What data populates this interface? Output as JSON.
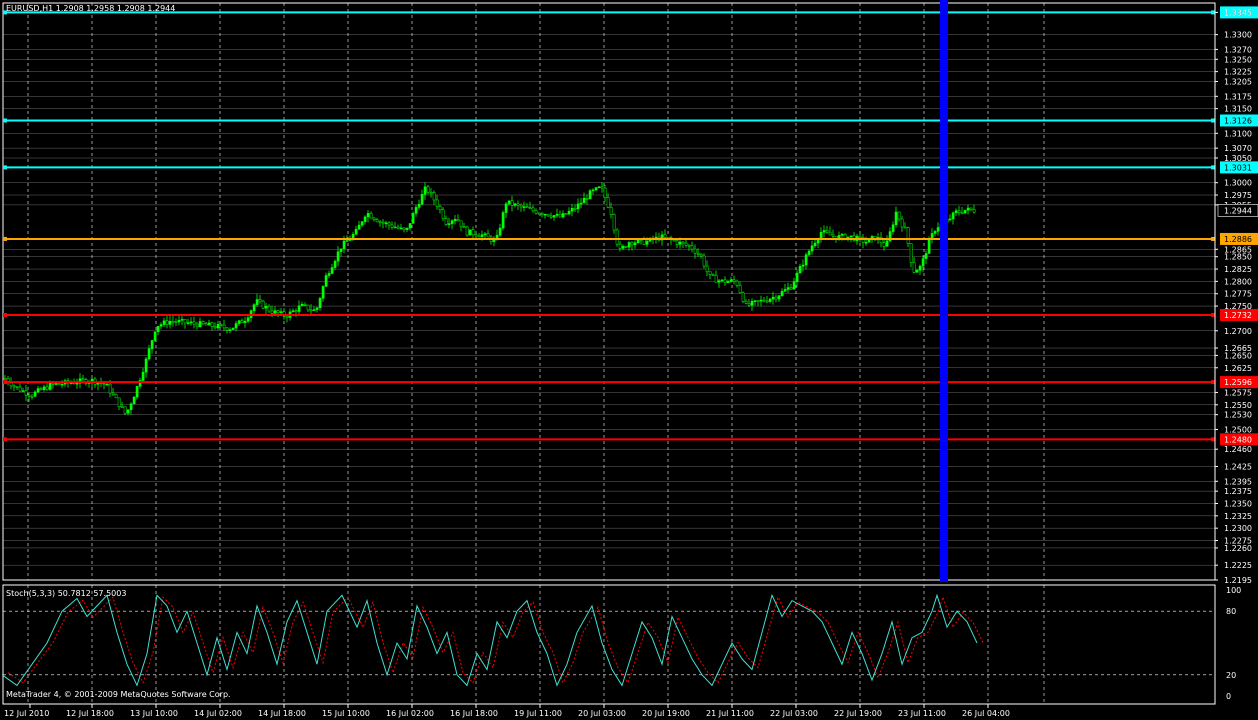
{
  "header": {
    "symbol_line": "EURUSD,H1  1.2908 1.2958 1.2908 1.2944"
  },
  "footer": {
    "copyright": "MetaTrader 4, © 2001-2009 MetaQuotes Software Corp."
  },
  "indicator": {
    "label": "Stoch(5,3,3) 50.7812 57.5003",
    "levels": [
      "100",
      "80",
      "20",
      "0"
    ],
    "level_values": [
      100,
      80,
      20,
      0
    ]
  },
  "colors": {
    "background": "#000000",
    "grid": "#ffffff",
    "bull_candle": "#00ff00",
    "hline_cyan": "#00ffff",
    "hline_orange": "#ffa500",
    "hline_red": "#ff0000",
    "vband_blue": "#0000ff",
    "stoch_main": "#40e0d0",
    "stoch_signal": "#ff0000"
  },
  "price_axis": {
    "ticks": [
      "1.3345",
      "1.3300",
      "1.3270",
      "1.3250",
      "1.3225",
      "1.3205",
      "1.3175",
      "1.3150",
      "1.3100",
      "1.3070",
      "1.3050",
      "1.3000",
      "1.2975",
      "1.2955",
      "1.2865",
      "1.2850",
      "1.2825",
      "1.2800",
      "1.2775",
      "1.2750",
      "1.2700",
      "1.2665",
      "1.2650",
      "1.2625",
      "1.2575",
      "1.2550",
      "1.2530",
      "1.2500",
      "1.2460",
      "1.2425",
      "1.2395",
      "1.2375",
      "1.2350",
      "1.2325",
      "1.2300",
      "1.2275",
      "1.2260",
      "1.2225",
      "1.2195"
    ],
    "current_price": "1.2944",
    "range": [
      1.2195,
      1.336
    ]
  },
  "horizontal_lines": [
    {
      "price": 1.3345,
      "label": "1.3345",
      "color": "cyan"
    },
    {
      "price": 1.3126,
      "label": "1.3126",
      "color": "cyan"
    },
    {
      "price": 1.3031,
      "label": "1.3031",
      "color": "cyan"
    },
    {
      "price": 1.2886,
      "label": "1.2886",
      "color": "orange"
    },
    {
      "price": 1.2732,
      "label": "1.2732",
      "color": "red"
    },
    {
      "price": 1.2596,
      "label": "1.2596",
      "color": "red"
    },
    {
      "price": 1.248,
      "label": "1.2480",
      "color": "red"
    }
  ],
  "time_axis": {
    "labels": [
      "12 Jul 2010",
      "12 Jul 18:00",
      "13 Jul 10:00",
      "14 Jul 02:00",
      "14 Jul 18:00",
      "15 Jul 10:00",
      "16 Jul 02:00",
      "16 Jul 18:00",
      "19 Jul 11:00",
      "20 Jul 03:00",
      "20 Jul 19:00",
      "21 Jul 11:00",
      "22 Jul 03:00",
      "22 Jul 19:00",
      "23 Jul 11:00",
      "26 Jul 04:00"
    ]
  },
  "chart_data": {
    "type": "line",
    "title": "EURUSD,H1",
    "price_range": [
      1.2195,
      1.336
    ],
    "close_path_points": [
      [
        0,
        1.261
      ],
      [
        15,
        1.2585
      ],
      [
        30,
        1.257
      ],
      [
        50,
        1.259
      ],
      [
        70,
        1.2595
      ],
      [
        90,
        1.26
      ],
      [
        105,
        1.259
      ],
      [
        115,
        1.256
      ],
      [
        125,
        1.253
      ],
      [
        135,
        1.258
      ],
      [
        145,
        1.264
      ],
      [
        155,
        1.271
      ],
      [
        170,
        1.272
      ],
      [
        190,
        1.2715
      ],
      [
        210,
        1.271
      ],
      [
        230,
        1.2705
      ],
      [
        245,
        1.2725
      ],
      [
        255,
        1.276
      ],
      [
        270,
        1.274
      ],
      [
        285,
        1.273
      ],
      [
        300,
        1.275
      ],
      [
        315,
        1.274
      ],
      [
        325,
        1.281
      ],
      [
        340,
        1.287
      ],
      [
        355,
        1.29
      ],
      [
        365,
        1.294
      ],
      [
        380,
        1.292
      ],
      [
        395,
        1.291
      ],
      [
        405,
        1.29
      ],
      [
        415,
        1.295
      ],
      [
        425,
        1.299
      ],
      [
        435,
        1.296
      ],
      [
        445,
        1.292
      ],
      [
        455,
        1.293
      ],
      [
        465,
        1.29
      ],
      [
        480,
        1.2895
      ],
      [
        495,
        1.288
      ],
      [
        505,
        1.296
      ],
      [
        520,
        1.295
      ],
      [
        540,
        1.294
      ],
      [
        560,
        1.293
      ],
      [
        575,
        1.295
      ],
      [
        590,
        1.298
      ],
      [
        600,
        1.299
      ],
      [
        610,
        1.294
      ],
      [
        618,
        1.286
      ],
      [
        628,
        1.288
      ],
      [
        645,
        1.288
      ],
      [
        660,
        1.289
      ],
      [
        675,
        1.288
      ],
      [
        690,
        1.287
      ],
      [
        700,
        1.285
      ],
      [
        708,
        1.281
      ],
      [
        720,
        1.28
      ],
      [
        735,
        1.28
      ],
      [
        745,
        1.275
      ],
      [
        760,
        1.276
      ],
      [
        775,
        1.277
      ],
      [
        790,
        1.279
      ],
      [
        800,
        1.283
      ],
      [
        810,
        1.287
      ],
      [
        820,
        1.29
      ],
      [
        835,
        1.289
      ],
      [
        850,
        1.289
      ],
      [
        865,
        1.288
      ],
      [
        875,
        1.289
      ],
      [
        885,
        1.287
      ],
      [
        895,
        1.294
      ],
      [
        905,
        1.29
      ],
      [
        912,
        1.282
      ],
      [
        920,
        1.283
      ],
      [
        928,
        1.288
      ],
      [
        935,
        1.291
      ],
      [
        945,
        1.292
      ],
      [
        955,
        1.294
      ],
      [
        965,
        1.2945
      ],
      [
        975,
        1.2944
      ]
    ],
    "stochastic_main": [
      [
        0,
        20
      ],
      [
        15,
        10
      ],
      [
        30,
        30
      ],
      [
        45,
        50
      ],
      [
        60,
        80
      ],
      [
        75,
        92
      ],
      [
        85,
        75
      ],
      [
        95,
        85
      ],
      [
        105,
        95
      ],
      [
        115,
        60
      ],
      [
        125,
        30
      ],
      [
        135,
        10
      ],
      [
        145,
        40
      ],
      [
        155,
        95
      ],
      [
        165,
        85
      ],
      [
        175,
        60
      ],
      [
        185,
        80
      ],
      [
        195,
        50
      ],
      [
        205,
        20
      ],
      [
        215,
        55
      ],
      [
        225,
        25
      ],
      [
        235,
        60
      ],
      [
        245,
        40
      ],
      [
        255,
        85
      ],
      [
        265,
        60
      ],
      [
        275,
        30
      ],
      [
        285,
        70
      ],
      [
        295,
        90
      ],
      [
        305,
        60
      ],
      [
        315,
        30
      ],
      [
        325,
        80
      ],
      [
        340,
        95
      ],
      [
        355,
        65
      ],
      [
        365,
        90
      ],
      [
        375,
        50
      ],
      [
        385,
        20
      ],
      [
        395,
        50
      ],
      [
        405,
        35
      ],
      [
        415,
        85
      ],
      [
        425,
        65
      ],
      [
        435,
        40
      ],
      [
        445,
        60
      ],
      [
        455,
        20
      ],
      [
        465,
        10
      ],
      [
        475,
        40
      ],
      [
        485,
        25
      ],
      [
        495,
        70
      ],
      [
        505,
        55
      ],
      [
        515,
        80
      ],
      [
        525,
        90
      ],
      [
        535,
        60
      ],
      [
        545,
        40
      ],
      [
        555,
        10
      ],
      [
        565,
        30
      ],
      [
        575,
        60
      ],
      [
        590,
        85
      ],
      [
        600,
        50
      ],
      [
        610,
        25
      ],
      [
        620,
        10
      ],
      [
        630,
        40
      ],
      [
        640,
        70
      ],
      [
        650,
        55
      ],
      [
        660,
        30
      ],
      [
        670,
        75
      ],
      [
        680,
        55
      ],
      [
        690,
        35
      ],
      [
        700,
        20
      ],
      [
        710,
        10
      ],
      [
        720,
        30
      ],
      [
        730,
        50
      ],
      [
        740,
        35
      ],
      [
        750,
        25
      ],
      [
        760,
        60
      ],
      [
        770,
        95
      ],
      [
        780,
        75
      ],
      [
        790,
        90
      ],
      [
        800,
        85
      ],
      [
        810,
        80
      ],
      [
        820,
        70
      ],
      [
        830,
        50
      ],
      [
        840,
        30
      ],
      [
        850,
        60
      ],
      [
        860,
        40
      ],
      [
        870,
        15
      ],
      [
        880,
        40
      ],
      [
        890,
        70
      ],
      [
        900,
        30
      ],
      [
        910,
        55
      ],
      [
        920,
        60
      ],
      [
        930,
        80
      ],
      [
        935,
        95
      ],
      [
        945,
        65
      ],
      [
        955,
        80
      ],
      [
        965,
        70
      ],
      [
        975,
        50
      ]
    ],
    "stochastic_levels": [
      80,
      20
    ]
  }
}
